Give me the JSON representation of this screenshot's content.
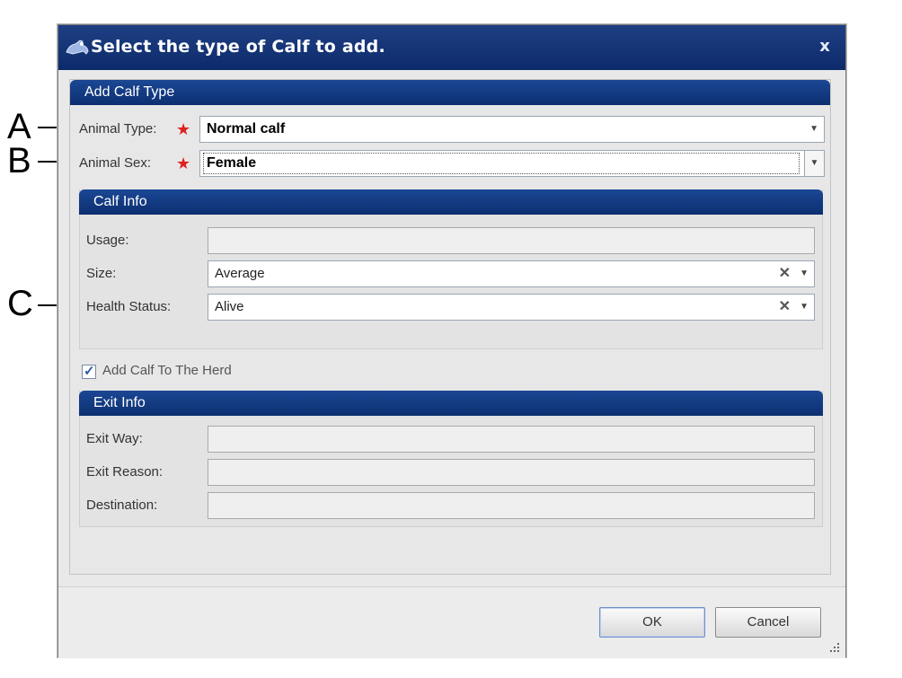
{
  "callouts": {
    "a": "A",
    "b": "B",
    "c": "C"
  },
  "dialog": {
    "title": "Select the type of Calf to add.",
    "close_glyph": "x"
  },
  "add_calf_type": {
    "header": "Add Calf Type",
    "animal_type": {
      "label": "Animal Type:",
      "required": "★",
      "value": "Normal calf"
    },
    "animal_sex": {
      "label": "Animal Sex:",
      "required": "★",
      "value": "Female"
    }
  },
  "calf_info": {
    "header": "Calf Info",
    "usage": {
      "label": "Usage:",
      "value": ""
    },
    "size": {
      "label": "Size:",
      "value": "Average"
    },
    "health_status": {
      "label": "Health Status:",
      "value": "Alive"
    }
  },
  "add_to_herd": {
    "label": "Add Calf To The Herd",
    "checked": true
  },
  "exit_info": {
    "header": "Exit Info",
    "exit_way": {
      "label": "Exit Way:",
      "value": ""
    },
    "exit_reason": {
      "label": "Exit Reason:",
      "value": ""
    },
    "destination": {
      "label": "Destination:",
      "value": ""
    }
  },
  "buttons": {
    "ok": "OK",
    "cancel": "Cancel"
  },
  "icons": {
    "title": "calf-icon",
    "close": "close-icon",
    "dropdown": "chevron-down-icon",
    "clear": "clear-icon",
    "check": "checkmark-icon",
    "resize": "resize-grip-icon"
  },
  "colors": {
    "title_bar": "#0d2b6b",
    "section_header": "#0c2f70",
    "required": "#e02020"
  }
}
